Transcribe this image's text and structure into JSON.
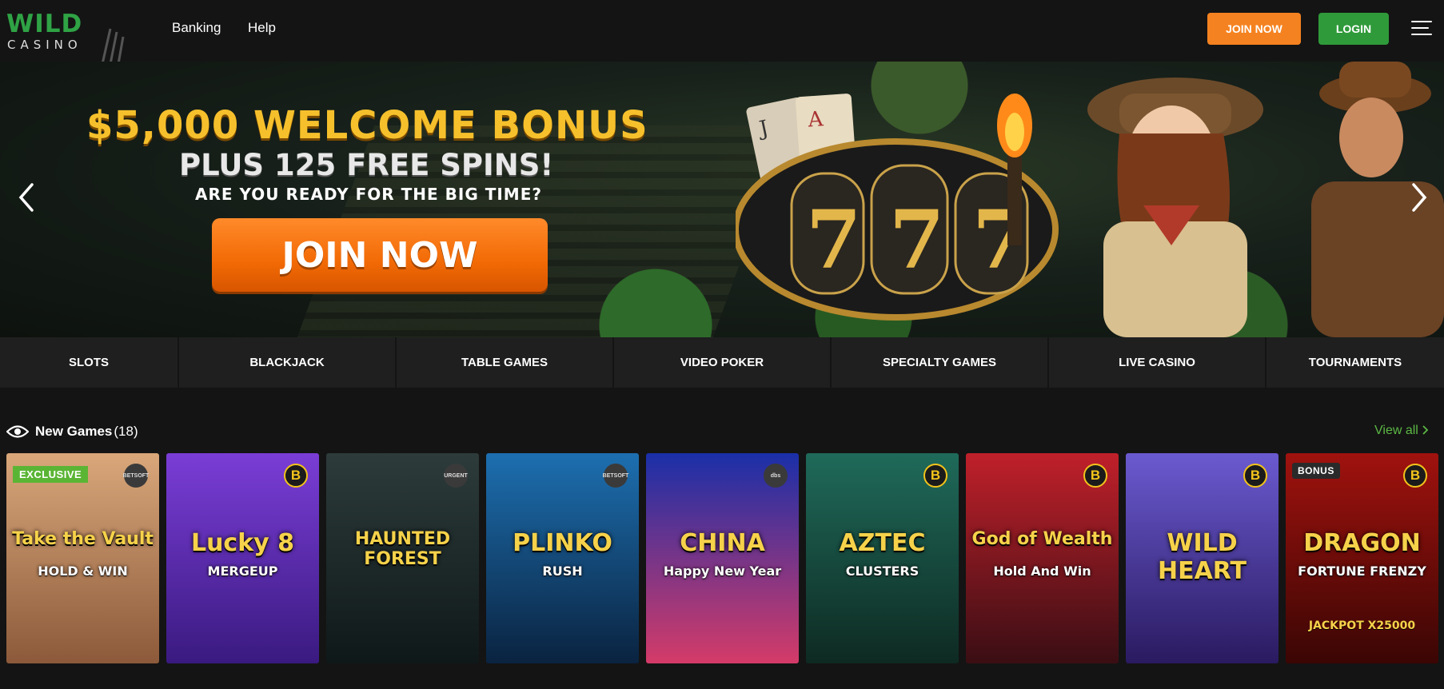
{
  "header": {
    "logo_main": "WILD",
    "logo_sub": "CASINO",
    "nav": [
      "Banking",
      "Help"
    ],
    "join_label": "JOIN NOW",
    "login_label": "LOGIN"
  },
  "hero": {
    "title1": "$5,000 WELCOME BONUS",
    "title2": "PLUS 125 FREE SPINS!",
    "title3": "ARE YOU READY FOR THE BIG TIME?",
    "cta": "JOIN NOW"
  },
  "categories": [
    "SLOTS",
    "BLACKJACK",
    "TABLE GAMES",
    "VIDEO POKER",
    "SPECIALTY GAMES",
    "LIVE CASINO",
    "TOURNAMENTS"
  ],
  "new_games": {
    "title": "New Games",
    "count": "(18)",
    "view_all": "View all",
    "tiles": [
      {
        "title": "Take the Vault",
        "sub": "HOLD & WIN",
        "badge": "EXCLUSIVE",
        "provider": "BETSOFT",
        "colors": [
          "#d9a77a",
          "#8c5a3a"
        ]
      },
      {
        "title": "Lucky 8",
        "sub": "MERGEUP",
        "badge": "",
        "provider": "B",
        "colors": [
          "#7a3dd6",
          "#3a1a80"
        ]
      },
      {
        "title": "HAUNTED FOREST",
        "sub": "",
        "badge": "",
        "provider": "URGENT",
        "colors": [
          "#2d3b3b",
          "#0f1818"
        ]
      },
      {
        "title": "PLINKO",
        "sub": "RUSH",
        "badge": "",
        "provider": "BETSOFT",
        "colors": [
          "#1d6fb0",
          "#0a2340"
        ]
      },
      {
        "title": "CHINA",
        "sub": "Happy New Year",
        "badge": "",
        "provider": "dbs",
        "colors": [
          "#1a2fa8",
          "#d43b68"
        ]
      },
      {
        "title": "AZTEC",
        "sub": "CLUSTERS",
        "badge": "",
        "provider": "B",
        "colors": [
          "#1f6a5a",
          "#0e2a22"
        ]
      },
      {
        "title": "God of Wealth",
        "sub": "Hold And Win",
        "badge": "",
        "provider": "B",
        "colors": [
          "#c0202a",
          "#3a0e14"
        ]
      },
      {
        "title": "WILD HEART",
        "sub": "",
        "badge": "",
        "provider": "B",
        "colors": [
          "#6a5ad0",
          "#2a1a60"
        ]
      },
      {
        "title": "DRAGON",
        "sub": "FORTUNE FRENZY",
        "sub2": "JACKPOT X25000",
        "badge": "BONUS",
        "provider": "B",
        "colors": [
          "#a0120e",
          "#3a0604"
        ]
      }
    ]
  }
}
